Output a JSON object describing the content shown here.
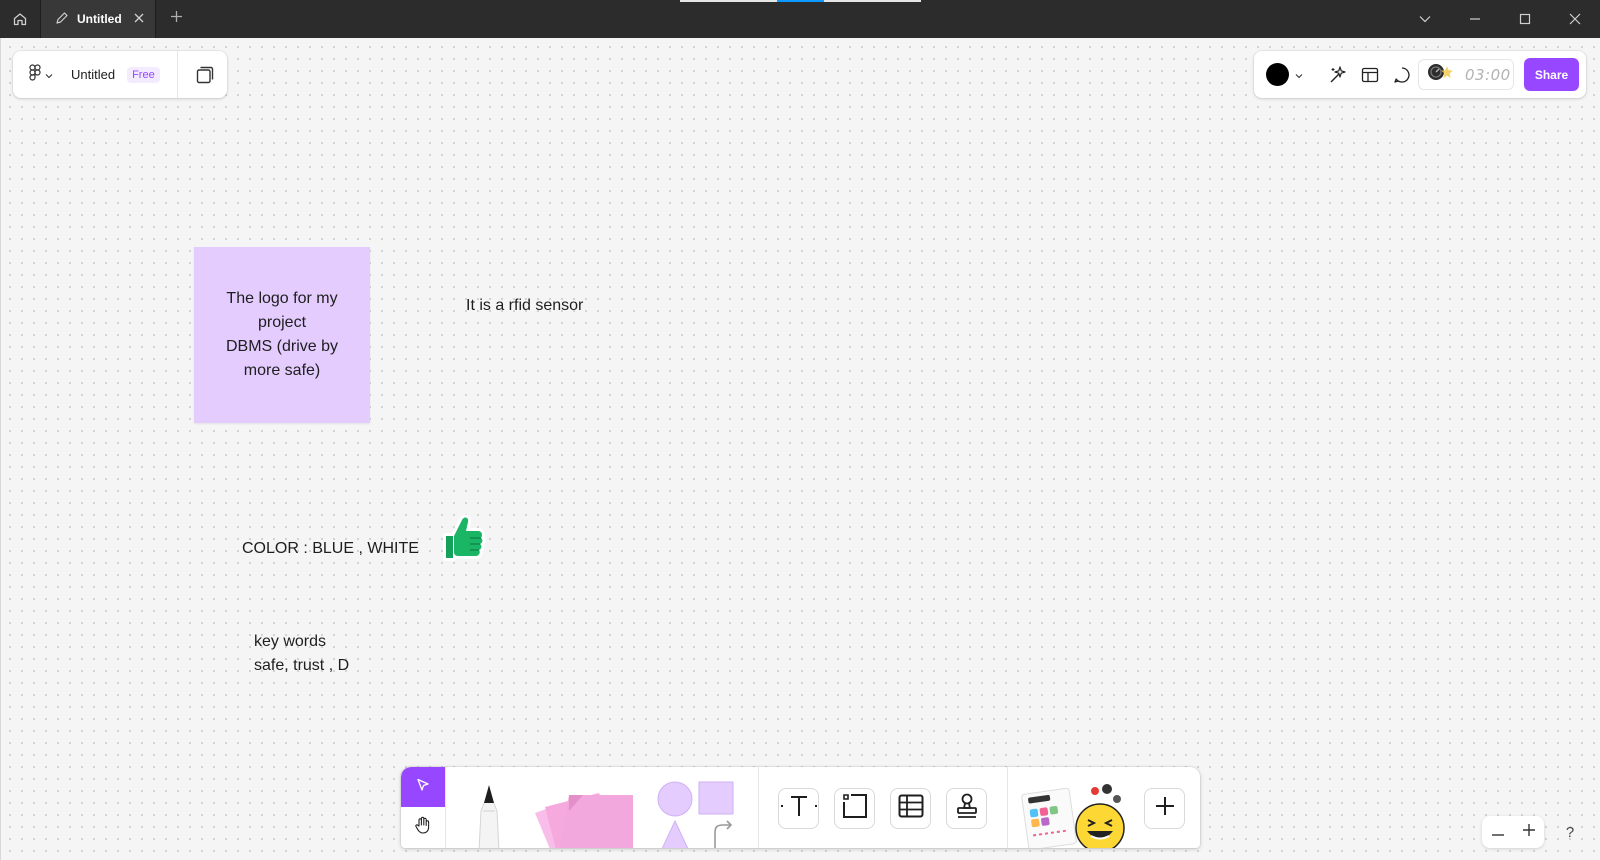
{
  "titlebar": {
    "tab_title": "Untitled",
    "icons": [
      "home-icon",
      "file-pen-icon",
      "close-icon",
      "plus-icon",
      "chevron-down-icon",
      "minimize-icon",
      "maximize-icon",
      "window-close-icon"
    ]
  },
  "file_panel": {
    "title": "Untitled",
    "badge": "Free"
  },
  "right_panel": {
    "current_color": "#000000",
    "timer": "03:00",
    "share_label": "Share",
    "icons": [
      "color-swatch-icon",
      "sparkle-ai-icon",
      "layout-template-icon",
      "comment-icon",
      "timer-icon"
    ]
  },
  "canvas": {
    "sticky_note": {
      "text": "The logo for my project\nDBMS (drive by more safe)",
      "color": "#e4ccff"
    },
    "text_rfid": "It is a rfid sensor",
    "text_color": "COLOR : BLUE , WHITE",
    "text_keywords": "key words\nsafe, trust , D",
    "sticker": "thumbs-up-sticker"
  },
  "bottom_toolbar": {
    "tools": [
      "select",
      "hand",
      "marker",
      "sticky-note",
      "shapes",
      "text",
      "section",
      "table",
      "stamp",
      "widgets",
      "add"
    ]
  },
  "zoom": {
    "help_label": "?"
  },
  "colors": {
    "accent": "#9747ff",
    "titlebar": "#2c2c2c",
    "canvas": "#f5f5f5"
  }
}
